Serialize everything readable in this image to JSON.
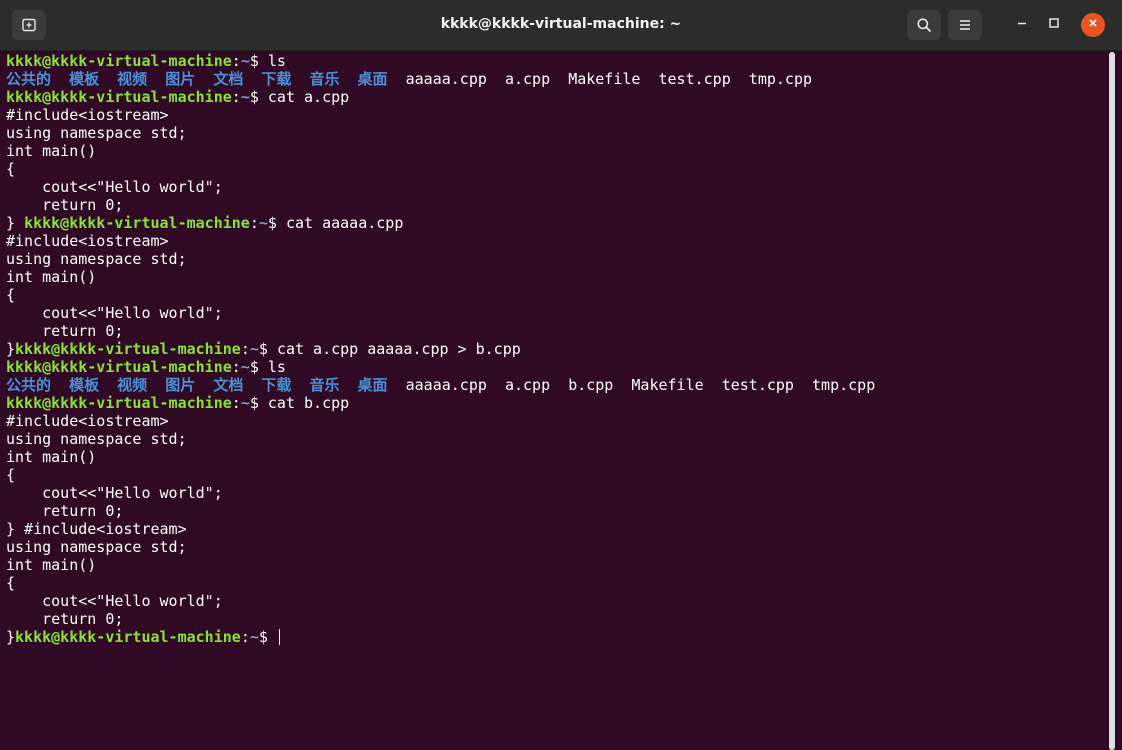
{
  "window": {
    "title": "kkkk@kkkk-virtual-machine: ~"
  },
  "icons": {
    "new_tab": "new-tab-icon",
    "search": "search-icon",
    "menu": "hamburger-menu-icon",
    "minimize": "minimize-icon",
    "maximize": "maximize-icon",
    "close": "close-icon"
  },
  "colors": {
    "terminal_bg": "#300a24",
    "prompt_user": "#8ae234",
    "prompt_path": "#729fcf",
    "directory": "#4a90d9",
    "close_button": "#e95420"
  },
  "terminal": {
    "prompt": {
      "user_host": "kkkk@kkkk-virtual-machine",
      "colon": ":",
      "path": "~",
      "symbol": "$ "
    },
    "lines": [
      {
        "type": "prompt",
        "lead": "",
        "command": "ls"
      },
      {
        "type": "ls",
        "dirs": [
          "公共的",
          "模板",
          "视频",
          "图片",
          "文档",
          "下载",
          "音乐",
          "桌面"
        ],
        "files": [
          "aaaaa.cpp",
          "a.cpp",
          "Makefile",
          "test.cpp",
          "tmp.cpp"
        ]
      },
      {
        "type": "prompt",
        "lead": "",
        "command": "cat a.cpp"
      },
      {
        "type": "text",
        "text": "#include<iostream>"
      },
      {
        "type": "text",
        "text": "using namespace std;"
      },
      {
        "type": "text",
        "text": "int main()"
      },
      {
        "type": "text",
        "text": "{"
      },
      {
        "type": "text",
        "text": "    cout<<\"Hello world\";"
      },
      {
        "type": "text",
        "text": "    return 0;"
      },
      {
        "type": "prompt",
        "lead": "} ",
        "command": "cat aaaaa.cpp"
      },
      {
        "type": "text",
        "text": "#include<iostream>"
      },
      {
        "type": "text",
        "text": "using namespace std;"
      },
      {
        "type": "text",
        "text": "int main()"
      },
      {
        "type": "text",
        "text": "{"
      },
      {
        "type": "text",
        "text": "    cout<<\"Hello world\";"
      },
      {
        "type": "text",
        "text": "    return 0;"
      },
      {
        "type": "prompt",
        "lead": "}",
        "command": "cat a.cpp aaaaa.cpp > b.cpp"
      },
      {
        "type": "prompt",
        "lead": "",
        "command": "ls"
      },
      {
        "type": "ls",
        "dirs": [
          "公共的",
          "模板",
          "视频",
          "图片",
          "文档",
          "下载",
          "音乐",
          "桌面"
        ],
        "files": [
          "aaaaa.cpp",
          "a.cpp",
          "b.cpp",
          "Makefile",
          "test.cpp",
          "tmp.cpp"
        ]
      },
      {
        "type": "prompt",
        "lead": "",
        "command": "cat b.cpp"
      },
      {
        "type": "text",
        "text": "#include<iostream>"
      },
      {
        "type": "text",
        "text": "using namespace std;"
      },
      {
        "type": "text",
        "text": "int main()"
      },
      {
        "type": "text",
        "text": "{"
      },
      {
        "type": "text",
        "text": "    cout<<\"Hello world\";"
      },
      {
        "type": "text",
        "text": "    return 0;"
      },
      {
        "type": "text",
        "text": "} #include<iostream>"
      },
      {
        "type": "text",
        "text": "using namespace std;"
      },
      {
        "type": "text",
        "text": "int main()"
      },
      {
        "type": "text",
        "text": "{"
      },
      {
        "type": "text",
        "text": "    cout<<\"Hello world\";"
      },
      {
        "type": "text",
        "text": "    return 0;"
      },
      {
        "type": "prompt",
        "lead": "}",
        "command": "",
        "cursor": true
      }
    ]
  }
}
